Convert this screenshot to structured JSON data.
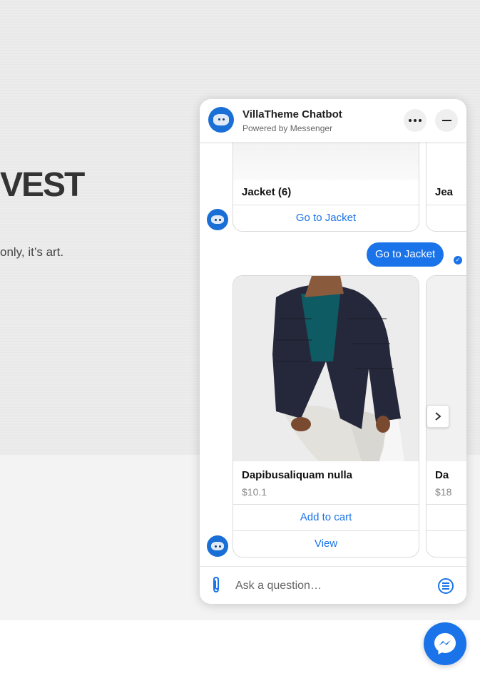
{
  "page": {
    "hero_title": "VEST",
    "hero_subtitle": "only, it’s art."
  },
  "chat": {
    "title": "VillaTheme Chatbot",
    "subtitle": "Powered by Messenger",
    "menu_icon": "more-dots-icon",
    "minimize_icon": "minimize-icon",
    "accent": "#1a73e8",
    "category_cards": [
      {
        "title": "Jacket (6)",
        "button": "Go to Jacket"
      },
      {
        "title": "Jea",
        "button": ""
      }
    ],
    "user_message": "Go to Jacket",
    "product_cards": [
      {
        "title": "Dapibusaliquam nulla",
        "price": "$10.1",
        "buttons": [
          "Add to cart",
          "View"
        ]
      },
      {
        "title": "Da",
        "price": "$18",
        "buttons": [
          "",
          ""
        ]
      }
    ],
    "composer": {
      "placeholder": "Ask a question…"
    }
  }
}
